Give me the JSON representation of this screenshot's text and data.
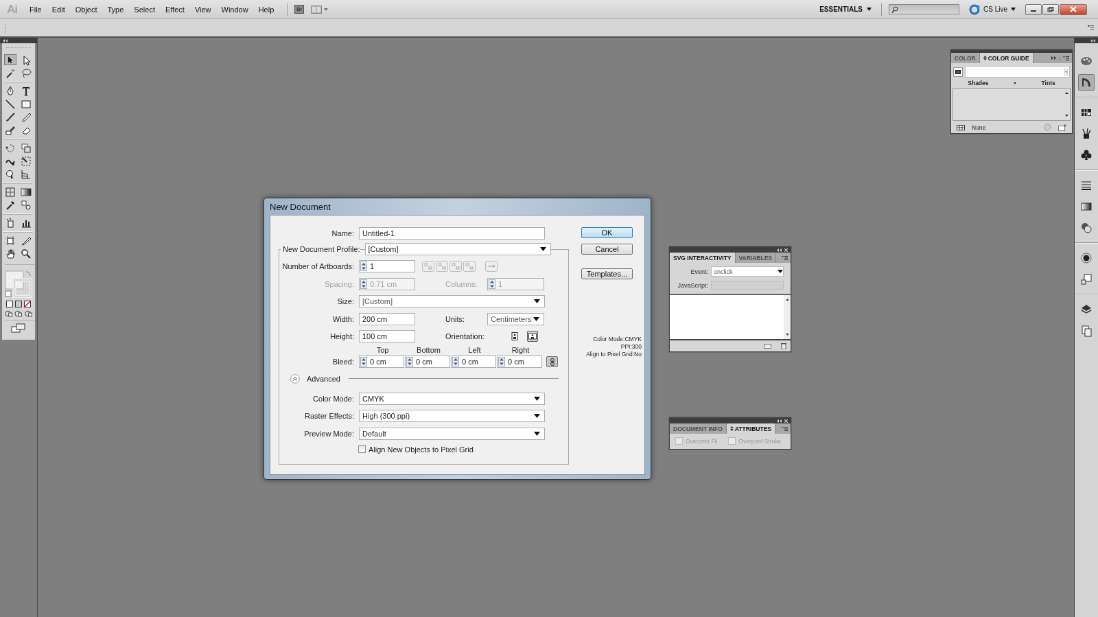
{
  "app": {
    "logo": "Ai",
    "menu": [
      "File",
      "Edit",
      "Object",
      "Type",
      "Select",
      "Effect",
      "View",
      "Window",
      "Help"
    ],
    "bridge": "Br",
    "workspace": "ESSENTIALS",
    "cs_live": "CS Live"
  },
  "dialog": {
    "title": "New Document",
    "name": {
      "label": "Name:",
      "value": "Untitled-1"
    },
    "profile": {
      "label": "New Document Profile:",
      "value": "[Custom]"
    },
    "artboards": {
      "label": "Number of Artboards:",
      "value": "1"
    },
    "spacing": {
      "label": "Spacing:",
      "value": "0.71 cm",
      "disabled": true
    },
    "columns": {
      "label": "Columns:",
      "value": "1",
      "disabled": true
    },
    "size": {
      "label": "Size:",
      "value": "[Custom]"
    },
    "width": {
      "label": "Width:",
      "value": "200 cm"
    },
    "units": {
      "label": "Units:",
      "value": "Centimeters"
    },
    "height": {
      "label": "Height:",
      "value": "100 cm"
    },
    "orientation": {
      "label": "Orientation:",
      "options": [
        {
          "kind": "portrait",
          "selected": false
        },
        {
          "kind": "landscape",
          "selected": true
        }
      ]
    },
    "bleed": {
      "label": "Bleed:",
      "linked": true,
      "sides": [
        {
          "label": "Top",
          "value": "0 cm"
        },
        {
          "label": "Bottom",
          "value": "0 cm"
        },
        {
          "label": "Left",
          "value": "0 cm"
        },
        {
          "label": "Right",
          "value": "0 cm"
        }
      ]
    },
    "advanced": {
      "label": "Advanced",
      "expanded": true
    },
    "color_mode": {
      "label": "Color Mode:",
      "value": "CMYK"
    },
    "raster_effects": {
      "label": "Raster Effects:",
      "value": "High (300 ppi)"
    },
    "preview_mode": {
      "label": "Preview Mode:",
      "value": "Default"
    },
    "align_to_grid": {
      "label": "Align New Objects to Pixel Grid",
      "checked": false
    },
    "buttons": [
      {
        "label": "OK",
        "default": true
      },
      {
        "label": "Cancel",
        "default": false
      },
      {
        "label": "Templates...",
        "default": false
      }
    ],
    "summary": [
      "Color Mode:CMYK",
      "PPI:300",
      "Align to Pixel Grid:No"
    ]
  },
  "color_guide": {
    "tabs": [
      {
        "label": "COLOR",
        "selected": false,
        "has_options": false
      },
      {
        "label": "COLOR GUIDE",
        "selected": true,
        "has_options": true
      }
    ],
    "shades": "Shades",
    "tints": "Tints",
    "status": "None"
  },
  "svg_panel": {
    "tabs": [
      {
        "label": "SVG INTERACTIVITY",
        "selected": true,
        "has_options": false
      },
      {
        "label": "VARIABLES",
        "selected": false,
        "has_options": false
      }
    ],
    "event": {
      "label": "Event:",
      "value": "onclick"
    },
    "javascript": {
      "label": "JavaScript:"
    }
  },
  "attributes_panel": {
    "tabs": [
      {
        "label": "DOCUMENT INFO",
        "selected": false,
        "has_options": false
      },
      {
        "label": "ATTRIBUTES",
        "selected": true,
        "has_options": true
      }
    ],
    "options": [
      {
        "label": "Overprint Fil",
        "checked": false,
        "disabled": true
      },
      {
        "label": "Overprint Stroke",
        "checked": false,
        "disabled": true
      }
    ]
  }
}
